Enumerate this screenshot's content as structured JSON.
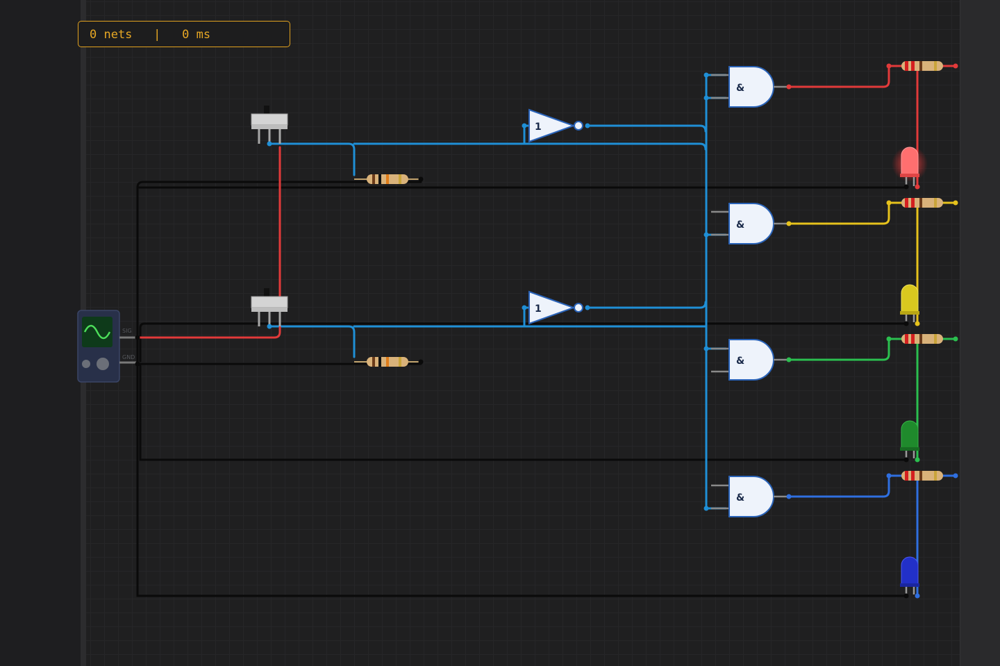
{
  "status_bar": {
    "nets": "0 nets",
    "separator": "|",
    "time": "0 ms"
  },
  "components": {
    "not_gate_label": "1",
    "and_gate_label": "&",
    "function_generator_pins": [
      "SIG",
      "GND"
    ]
  },
  "colors": {
    "wire_signal": "#1f8fd6",
    "wire_red": "#e23a3a",
    "wire_yellow": "#e6c21c",
    "wire_green": "#2bbf4f",
    "wire_blue": "#2f6fe0",
    "wire_ground": "#0a0a0a",
    "status_accent": "#e2a21f"
  },
  "leds": [
    "red",
    "yellow",
    "green",
    "blue"
  ]
}
